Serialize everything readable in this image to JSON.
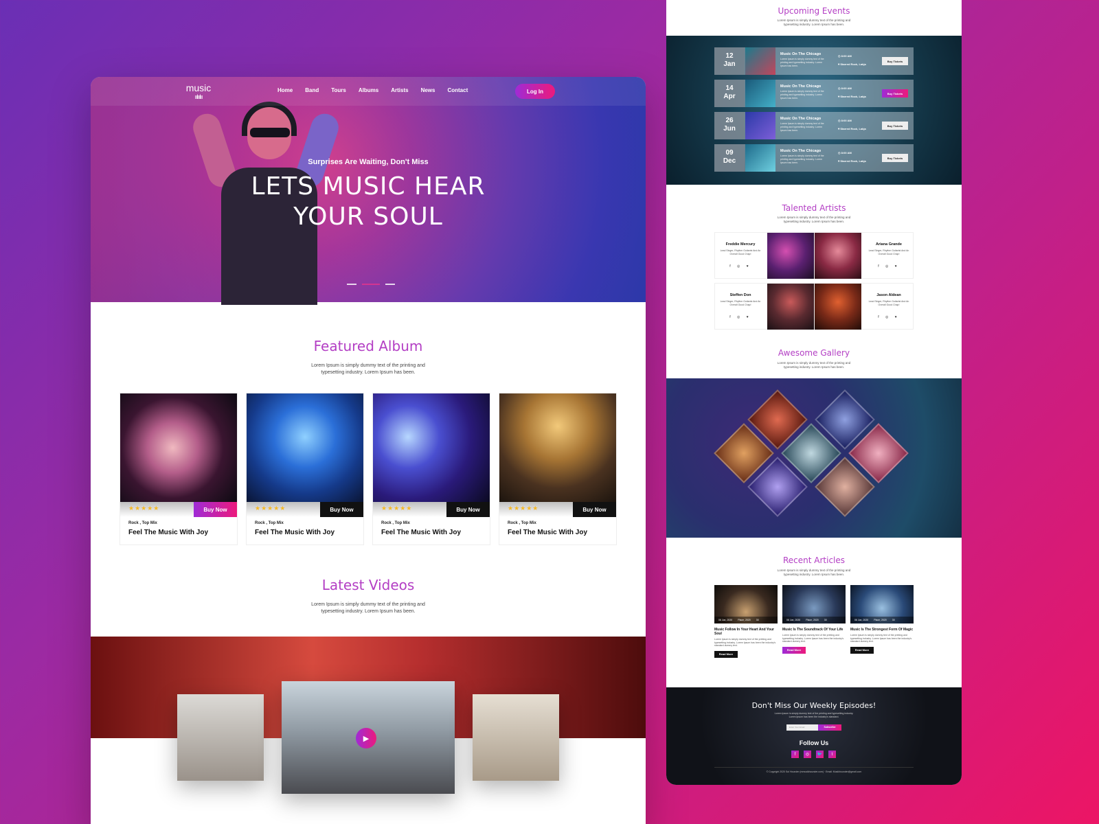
{
  "nav": {
    "logo": "music",
    "logo_wave": "ıılıılıı",
    "items": [
      "Home",
      "Band",
      "Tours",
      "Albums",
      "Artists",
      "News",
      "Contact"
    ],
    "login": "Log In"
  },
  "hero": {
    "subtitle": "Surprises Are Waiting, Don't Miss",
    "title_line1": "LETS MUSIC HEAR",
    "title_line2": "YOUR SOUL"
  },
  "featured": {
    "title": "Featured Album",
    "desc_line1": "Lorem Ipsum is simply dummy text of the printing and",
    "desc_line2": "typesetting industry. Lorem Ipsum has been.",
    "albums": [
      {
        "stars": "★★★★★",
        "buy": "Buy Now",
        "category": "Rock , Top Mix",
        "name": "Feel The Music With Joy"
      },
      {
        "stars": "★★★★★",
        "buy": "Buy Now",
        "category": "Rock , Top Mix",
        "name": "Feel The Music With Joy"
      },
      {
        "stars": "★★★★★",
        "buy": "Buy Now",
        "category": "Rock , Top Mix",
        "name": "Feel The Music With Joy"
      },
      {
        "stars": "★★★★★",
        "buy": "Buy Now",
        "category": "Rock , Top Mix",
        "name": "Feel The Music With Joy"
      }
    ]
  },
  "videos": {
    "title": "Latest Videos",
    "desc_line1": "Lorem Ipsum is simply dummy text of the printing and",
    "desc_line2": "typesetting industry. Lorem Ipsum has been.",
    "play": "▶"
  },
  "events": {
    "title": "Upcoming Events",
    "desc_line1": "Lorem Ipsum is simply dummy text of the printing and",
    "desc_line2": "typesetting industry. Lorem Ipsum has been.",
    "items": [
      {
        "day": "12",
        "month": "Jan",
        "title": "Music On The Chicago",
        "desc": "Lorem Ipsum is simply dummy text of the printing and typesetting industry. Lorem Ipsum has been.",
        "time": "8:00 AM",
        "location": "Starred Rock, Lakja",
        "ticket": "Buy Tickets"
      },
      {
        "day": "14",
        "month": "Apr",
        "title": "Music On The Chicago",
        "desc": "Lorem Ipsum is simply dummy text of the printing and typesetting industry. Lorem Ipsum has been.",
        "time": "8:00 AM",
        "location": "Starred Rock, Lakja",
        "ticket": "Buy Tickets"
      },
      {
        "day": "26",
        "month": "Jun",
        "title": "Music On The Chicago",
        "desc": "Lorem Ipsum is simply dummy text of the printing and typesetting industry. Lorem Ipsum has been.",
        "time": "8:00 AM",
        "location": "Starred Rock, Lakja",
        "ticket": "Buy Tickets"
      },
      {
        "day": "09",
        "month": "Dec",
        "title": "Music On The Chicago",
        "desc": "Lorem Ipsum is simply dummy text of the printing and typesetting industry. Lorem Ipsum has been.",
        "time": "8:00 AM",
        "location": "Starred Rock, Lakja",
        "ticket": "Buy Tickets"
      }
    ]
  },
  "artists": {
    "title": "Talented Artists",
    "desc_line1": "Lorem Ipsum is simply dummy text of the printing and",
    "desc_line2": "typesetting industry. Lorem Ipsum has been.",
    "items": [
      {
        "name": "Freddie Mercury",
        "desc": "Lead Singer, Rhythm Guitarist And An Overall Good Chap!",
        "social": "f ◎ ♥"
      },
      {
        "name": "Ariana Grande",
        "desc": "Lead Singer, Rhythm Guitarist And An Overall Good Chap!",
        "social": "f ◎ ♥"
      },
      {
        "name": "Steffen Don",
        "desc": "Lead Singer, Rhythm Guitarist And An Overall Good Chap!",
        "social": "f ◎ ♥"
      },
      {
        "name": "Jason Aldean",
        "desc": "Lead Singer, Rhythm Guitarist And An Overall Good Chap!",
        "social": "f ◎ ♥"
      }
    ]
  },
  "gallery": {
    "title": "Awesome Gallery",
    "desc_line1": "Lorem Ipsum is simply dummy text of the printing and",
    "desc_line2": "typesetting industry. Lorem Ipsum has been."
  },
  "articles": {
    "title": "Recent Articles",
    "desc_line1": "Lorem Ipsum is simply dummy text of the printing and",
    "desc_line2": "typesetting industry. Lorem Ipsum has been.",
    "items": [
      {
        "date": "06 Jun, 2020",
        "place": "Place, 2020",
        "count": "30",
        "title": "Music Follow In Your Heart And Your Soul",
        "desc": "Lorem Ipsum is simply dummy text of the printing and typesetting industry. Lorem Ipsum has been the industry's standard dummy text.",
        "read": "Read More"
      },
      {
        "date": "06 Jun, 2020",
        "place": "Place, 2020",
        "count": "30",
        "title": "Music Is The Soundtrack Of Your Life",
        "desc": "Lorem Ipsum is simply dummy text of the printing and typesetting industry. Lorem Ipsum has been the industry's standard dummy text.",
        "read": "Read More"
      },
      {
        "date": "06 Jun, 2020",
        "place": "Place, 2020",
        "count": "30",
        "title": "Music Is The Strongest Form Of Magic",
        "desc": "Lorem Ipsum is simply dummy text of the printing and typesetting industry. Lorem Ipsum has been the industry's standard dummy text.",
        "read": "Read More"
      }
    ]
  },
  "footer": {
    "title": "Don't Miss Our Weekly Episodes!",
    "desc_line1": "Lorem Ipsum is simply dummy text of the printing and typesetting industry.",
    "desc_line2": "Lorem Ipsum has been the industry's standard.",
    "input_placeholder": "Enter Your Email",
    "subscribe": "Subscribe",
    "follow": "Follow Us",
    "social": [
      "f",
      "◎",
      "🐦",
      "t"
    ],
    "copyright": "© Copyright 2020 Sol Hounder (mmusikhounder.com) · Email: Musikhounder@gmail.com"
  }
}
